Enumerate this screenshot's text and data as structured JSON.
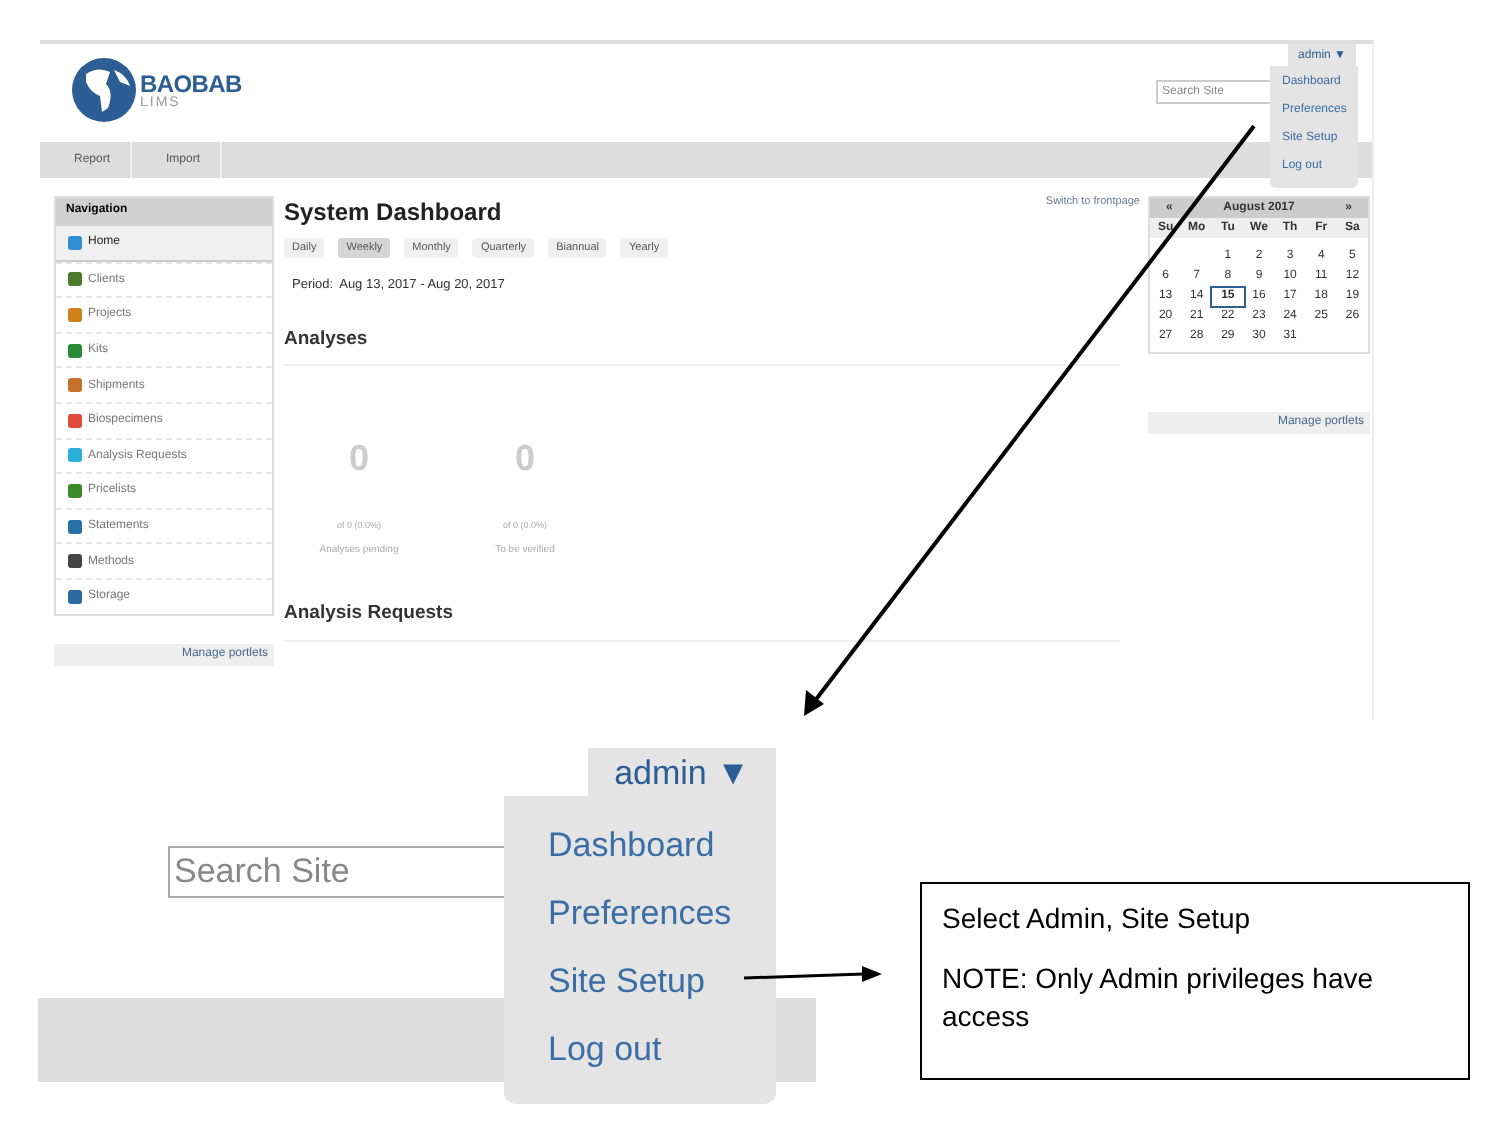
{
  "screenshot": {
    "logo": {
      "name": "BAOBAB",
      "sub": "LIMS"
    },
    "search": {
      "placeholder": "Search Site"
    },
    "user_menu": {
      "label": "admin ▼",
      "items": [
        "Dashboard",
        "Preferences",
        "Site Setup",
        "Log out"
      ]
    },
    "nav_tabs": [
      "Report",
      "Import"
    ],
    "navigation": {
      "title": "Navigation",
      "items": [
        {
          "label": "Home",
          "selected": true,
          "color": "#2f8fd0"
        },
        {
          "label": "Clients",
          "selected": false,
          "color": "#4a7a2a"
        },
        {
          "label": "Projects",
          "selected": false,
          "color": "#d0801a"
        },
        {
          "label": "Kits",
          "selected": false,
          "color": "#2a8a3a"
        },
        {
          "label": "Shipments",
          "selected": false,
          "color": "#c8702a"
        },
        {
          "label": "Biospecimens",
          "selected": false,
          "color": "#e04a3a"
        },
        {
          "label": "Analysis Requests",
          "selected": false,
          "color": "#2ab0d8"
        },
        {
          "label": "Pricelists",
          "selected": false,
          "color": "#3a8a2a"
        },
        {
          "label": "Statements",
          "selected": false,
          "color": "#2a70a8"
        },
        {
          "label": "Methods",
          "selected": false,
          "color": "#444444"
        },
        {
          "label": "Storage",
          "selected": false,
          "color": "#2a6aa0"
        }
      ],
      "manage": "Manage portlets"
    },
    "dashboard": {
      "title": "System Dashboard",
      "switch_link": "Switch to frontpage",
      "periods": [
        {
          "label": "Daily",
          "selected": false
        },
        {
          "label": "Weekly",
          "selected": true
        },
        {
          "label": "Monthly",
          "selected": false
        },
        {
          "label": "Quarterly",
          "selected": false
        },
        {
          "label": "Biannual",
          "selected": false
        },
        {
          "label": "Yearly",
          "selected": false
        }
      ],
      "period_label": "Period:",
      "period_value": "Aug 13, 2017 -  Aug 20, 2017",
      "analyses_title": "Analyses",
      "stats": [
        {
          "value": "0",
          "detail": "of 0 (0.0%)",
          "caption": "Analyses pending"
        },
        {
          "value": "0",
          "detail": "of 0 (0.0%)",
          "caption": "To be verified"
        }
      ],
      "requests_title": "Analysis Requests"
    },
    "calendar": {
      "prev": "«",
      "month": "August 2017",
      "next": "»",
      "weekdays": [
        "Su",
        "Mo",
        "Tu",
        "We",
        "Th",
        "Fr",
        "Sa"
      ],
      "weeks": [
        [
          {
            "day": "1",
            "selected": false
          },
          {
            "day": "2",
            "selected": false
          },
          {
            "day": "3",
            "selected": false
          },
          {
            "day": "4",
            "selected": false
          },
          {
            "day": "5",
            "selected": false
          }
        ],
        [
          {
            "day": "6",
            "selected": false
          },
          {
            "day": "7",
            "selected": false
          },
          {
            "day": "8",
            "selected": false
          },
          {
            "day": "9",
            "selected": false
          },
          {
            "day": "10",
            "selected": false
          },
          {
            "day": "11",
            "selected": false
          },
          {
            "day": "12",
            "selected": false
          }
        ],
        [
          {
            "day": "13",
            "selected": false
          },
          {
            "day": "14",
            "selected": false
          },
          {
            "day": "15",
            "selected": true
          },
          {
            "day": "16",
            "selected": false
          },
          {
            "day": "17",
            "selected": false
          },
          {
            "day": "18",
            "selected": false
          },
          {
            "day": "19",
            "selected": false
          }
        ],
        [
          {
            "day": "20",
            "selected": false
          },
          {
            "day": "21",
            "selected": false
          },
          {
            "day": "22",
            "selected": false
          },
          {
            "day": "23",
            "selected": false
          },
          {
            "day": "24",
            "selected": false
          },
          {
            "day": "25",
            "selected": false
          },
          {
            "day": "26",
            "selected": false
          }
        ],
        [
          {
            "day": "27",
            "selected": false
          },
          {
            "day": "28",
            "selected": false
          },
          {
            "day": "29",
            "selected": false
          },
          {
            "day": "30",
            "selected": false
          },
          {
            "day": "31",
            "selected": false
          }
        ]
      ]
    },
    "manage_right": "Manage portlets"
  },
  "zoom": {
    "search": {
      "placeholder": "Search Site"
    },
    "user_menu": {
      "label": "admin ▼",
      "items": [
        "Dashboard",
        "Preferences",
        "Site Setup",
        "Log out"
      ]
    }
  },
  "callout": {
    "lines": [
      "Select Admin, Site Setup",
      "NOTE: Only Admin privileges have access"
    ]
  }
}
